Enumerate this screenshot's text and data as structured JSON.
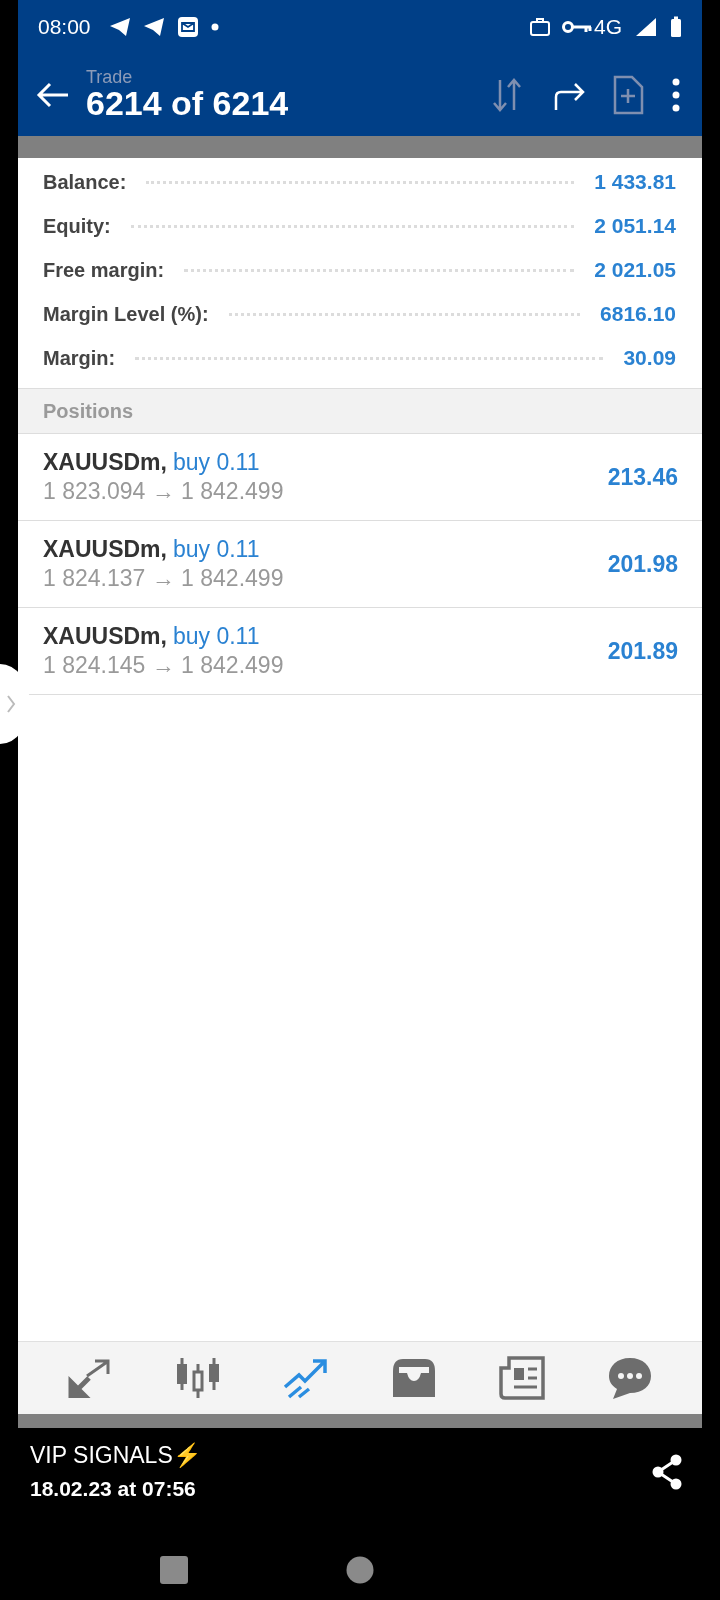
{
  "status_bar": {
    "time": "08:00",
    "network": "4G"
  },
  "viewer": {
    "title": "6214 of 6214"
  },
  "app_header": {
    "title": "Trade"
  },
  "account": [
    {
      "label": "Balance:",
      "value": "1 433.81"
    },
    {
      "label": "Equity:",
      "value": "2 051.14"
    },
    {
      "label": "Free margin:",
      "value": "2 021.05"
    },
    {
      "label": "Margin Level (%):",
      "value": "6816.10"
    },
    {
      "label": "Margin:",
      "value": "30.09"
    }
  ],
  "positions": {
    "title": "Positions",
    "rows": [
      {
        "symbol": "XAUUSDm,",
        "side": "buy 0.11",
        "prices": "1 823.094 → 1 842.499",
        "profit": "213.46"
      },
      {
        "symbol": "XAUUSDm,",
        "side": "buy 0.11",
        "prices": "1 824.137 → 1 842.499",
        "profit": "201.98"
      },
      {
        "symbol": "XAUUSDm,",
        "side": "buy 0.11",
        "prices": "1 824.145 → 1 842.499",
        "profit": "201.89"
      }
    ]
  },
  "bottom_nav": [
    {
      "kind": "quotes",
      "selected": false
    },
    {
      "kind": "chart",
      "selected": false
    },
    {
      "kind": "trade",
      "selected": true
    },
    {
      "kind": "history",
      "selected": false
    },
    {
      "kind": "news",
      "selected": false
    },
    {
      "kind": "chat",
      "selected": false
    }
  ],
  "caption": {
    "title": "VIP SIGNALS⚡",
    "date": "18.02.23 at 07:56"
  }
}
